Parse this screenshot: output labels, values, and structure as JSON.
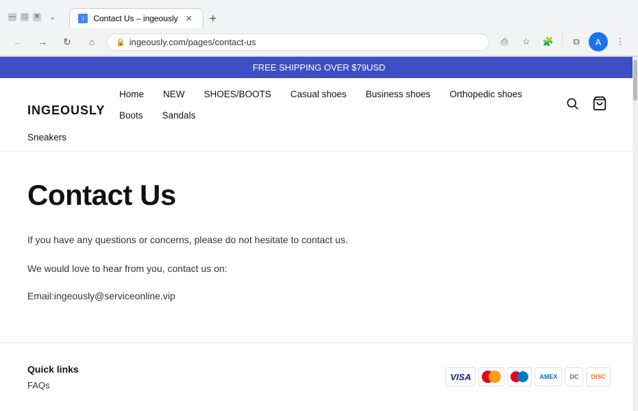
{
  "browser": {
    "tab_title": "Contact Us – ingeously",
    "favicon_text": "i",
    "url": "ingeously.com/pages/contact-us",
    "new_tab_label": "+",
    "back_btn": "←",
    "forward_btn": "→",
    "reload_btn": "↻",
    "home_btn": "⌂",
    "share_icon": "⎙",
    "bookmark_icon": "☆",
    "extensions_icon": "🧩",
    "split_icon": "⧉",
    "profile_letter": "A",
    "more_icon": "⋮"
  },
  "site": {
    "promo_text": "FREE SHIPPING OVER $79USD",
    "logo": "INGEOUSLY",
    "nav_items": [
      {
        "label": "Home"
      },
      {
        "label": "NEW"
      },
      {
        "label": "SHOES/BOOTS"
      },
      {
        "label": "Casual shoes"
      },
      {
        "label": "Business shoes"
      },
      {
        "label": "Orthopedic shoes"
      },
      {
        "label": "Boots"
      },
      {
        "label": "Sandals"
      }
    ],
    "nav_row2": [
      {
        "label": "Sneakers"
      }
    ],
    "search_icon": "🔍",
    "cart_icon": "🛒"
  },
  "page": {
    "title": "Contact Us",
    "paragraph1": "If you have any questions or concerns, please do not hesitate to contact us.",
    "paragraph2": "We would love to hear from you, contact us on:",
    "email_line": "Email:ingeously@serviceonline.vip"
  },
  "footer": {
    "quick_links_label": "Quick links",
    "faqs_label": "FAQs",
    "payment_methods": [
      {
        "name": "visa",
        "label": "VISA"
      },
      {
        "name": "mastercard",
        "label": "MC"
      },
      {
        "name": "maestro",
        "label": ""
      },
      {
        "name": "amex",
        "label": "AMEX"
      },
      {
        "name": "diners",
        "label": "DC"
      },
      {
        "name": "discover",
        "label": "DISC"
      }
    ]
  }
}
